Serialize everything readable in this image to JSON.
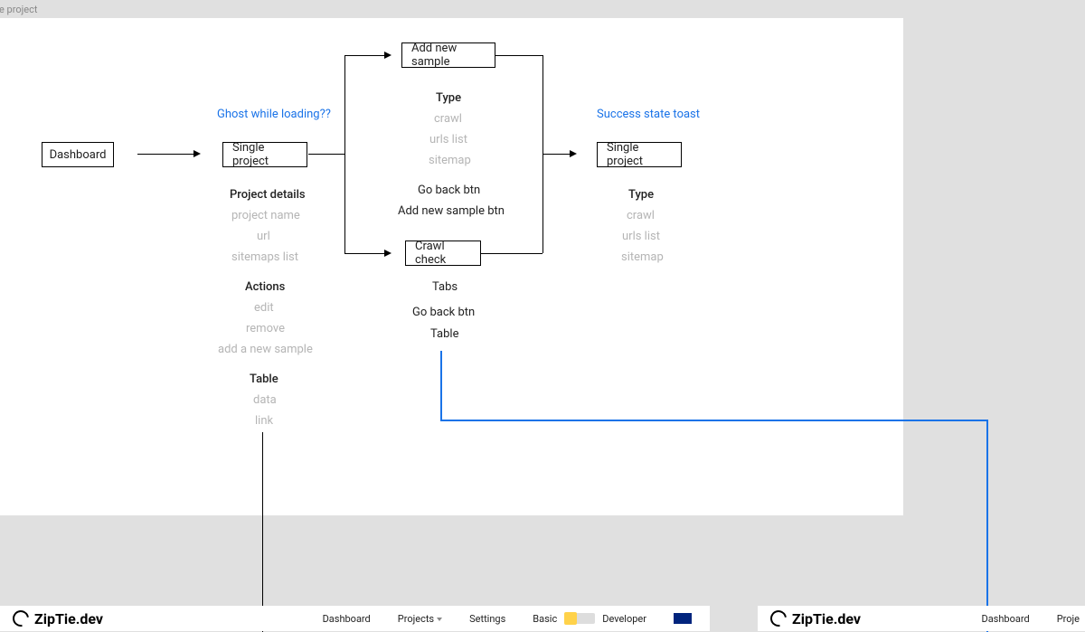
{
  "corner": "e project",
  "annotations": {
    "ghost": "Ghost while loading??",
    "success": "Success state toast"
  },
  "nodes": {
    "dashboard": "Dashboard",
    "single_project_1": "Single project",
    "add_sample": "Add new sample",
    "crawl_check": "Crawl check",
    "single_project_2": "Single project"
  },
  "col2": {
    "h1": "Project details",
    "i1": "project name",
    "i2": "url",
    "i3": "sitemaps list",
    "h2": "Actions",
    "a1": "edit",
    "a2": "remove",
    "a3": "add a new sample",
    "h3": "Table",
    "t1": "data",
    "t2": "link"
  },
  "col3a": {
    "h1": "Type",
    "i1": "crawl",
    "i2": "urls list",
    "i3": "sitemap",
    "b1": "Go back btn",
    "b2": "Add new sample btn"
  },
  "col3b": {
    "i1": "Tabs",
    "i2": "Go back btn",
    "i3": "Table"
  },
  "col4": {
    "h1": "Type",
    "i1": "crawl",
    "i2": "urls list",
    "i3": "sitemap"
  },
  "nav": {
    "brand": "ZipTie.dev",
    "dashboard": "Dashboard",
    "projects": "Projects",
    "settings": "Settings",
    "basic": "Basic",
    "developer": "Developer",
    "proje": "Proje"
  }
}
